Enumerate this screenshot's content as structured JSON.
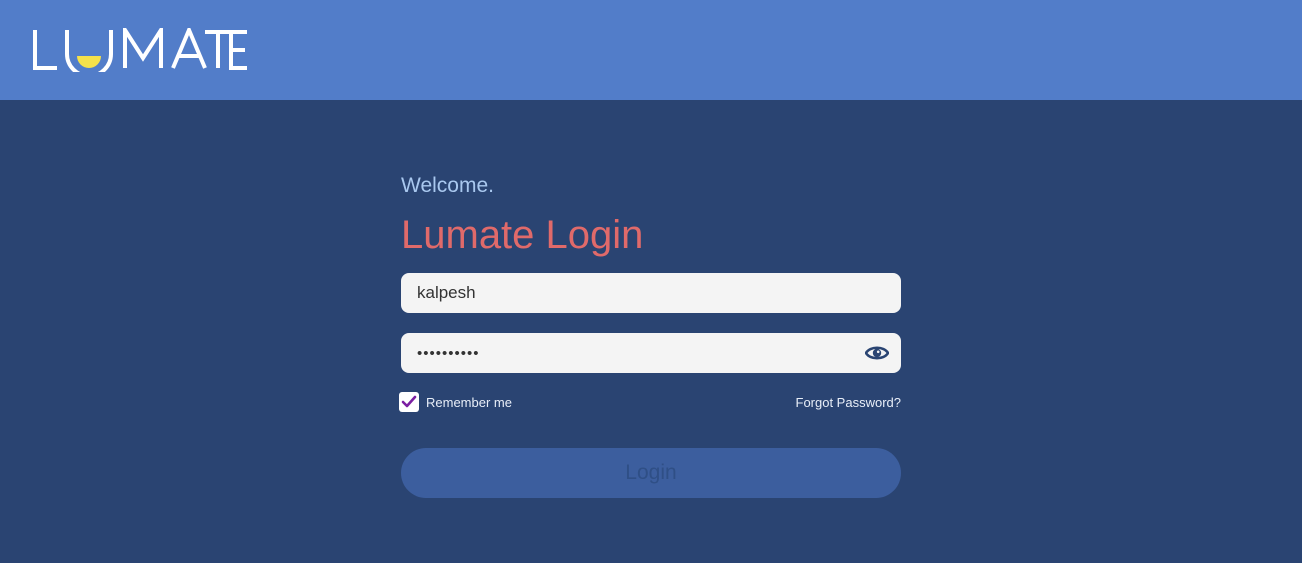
{
  "brand": {
    "logo_text": "LUMATE",
    "header_color": "#527dc9",
    "accent_yellow": "#f5e14a"
  },
  "login_form": {
    "welcome": "Welcome.",
    "title": "Lumate Login",
    "username_value": "kalpesh",
    "password_value": "••••••••••",
    "password_visibility_icon": "eye-icon",
    "remember_me_label": "Remember me",
    "remember_me_checked": true,
    "forgot_password_label": "Forgot Password?",
    "login_button_label": "Login"
  },
  "colors": {
    "background": "#2a4472",
    "title": "#e06a6a",
    "welcome": "#a9c8ef",
    "field_background": "#f4f4f4",
    "button": "#3c5e9e",
    "checkmark": "#7b1fa2"
  }
}
